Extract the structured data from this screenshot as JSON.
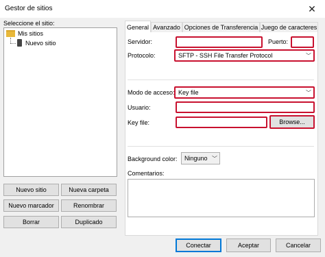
{
  "window": {
    "title": "Gestor de sitios",
    "close": "✕"
  },
  "left": {
    "select_label": "Seleccione el sitio:",
    "tree": {
      "folder": "Mis sitios",
      "site": "Nuevo sitio"
    },
    "buttons": {
      "new_site": "Nuevo sitio",
      "new_folder": "Nueva carpeta",
      "new_bookmark": "Nuevo marcador",
      "rename": "Renombrar",
      "delete": "Borrar",
      "duplicate": "Duplicado"
    }
  },
  "tabs": [
    "General",
    "Avanzado",
    "Opciones de Transferencia",
    "Juego de caracteres"
  ],
  "general": {
    "server_label": "Servidor:",
    "server_value": "",
    "port_label": "Puerto:",
    "port_value": "",
    "protocol_label": "Protocolo:",
    "protocol_value": "SFTP - SSH File Transfer Protocol",
    "access_mode_label": "Modo de acceso:",
    "access_mode_value": "Key file",
    "user_label": "Usuario:",
    "user_value": "",
    "keyfile_label": "Key file:",
    "keyfile_value": "",
    "browse": "Browse...",
    "bg_color_label": "Background color:",
    "bg_color_value": "Ninguno",
    "comments_label": "Comentarios:"
  },
  "footer": {
    "connect": "Conectar",
    "accept": "Aceptar",
    "cancel": "Cancelar"
  },
  "colors": {
    "highlight": "#c8102e",
    "focus": "#0078d7"
  }
}
